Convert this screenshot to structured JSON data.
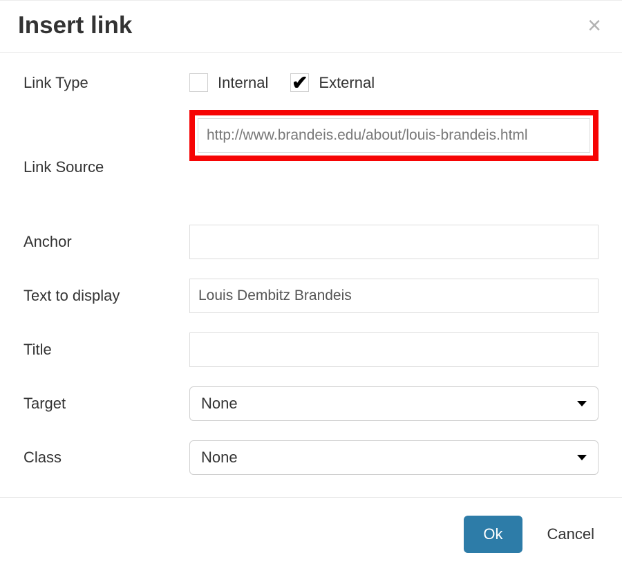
{
  "header": {
    "title": "Insert link",
    "close_glyph": "×"
  },
  "fields": {
    "link_type": {
      "label": "Link Type",
      "options": {
        "internal": {
          "label": "Internal",
          "checked": false
        },
        "external": {
          "label": "External",
          "checked": true
        }
      }
    },
    "link_source": {
      "label": "Link Source",
      "value": "http://www.brandeis.edu/about/louis-brandeis.html",
      "highlighted": true
    },
    "anchor": {
      "label": "Anchor",
      "value": ""
    },
    "text_to_display": {
      "label": "Text to display",
      "value": "Louis Dembitz Brandeis"
    },
    "title": {
      "label": "Title",
      "value": ""
    },
    "target": {
      "label": "Target",
      "selected": "None"
    },
    "class": {
      "label": "Class",
      "selected": "None"
    }
  },
  "footer": {
    "ok_label": "Ok",
    "cancel_label": "Cancel"
  }
}
